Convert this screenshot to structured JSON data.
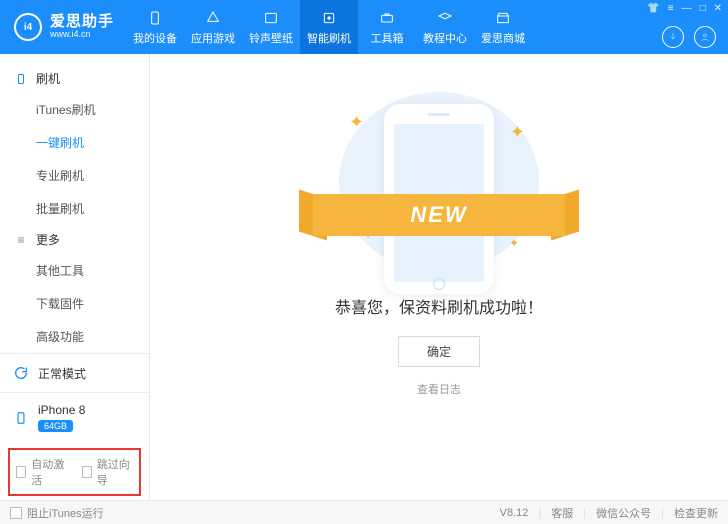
{
  "brand": {
    "name": "爱思助手",
    "url": "www.i4.cn",
    "logo_text": "i4"
  },
  "top_nav": [
    {
      "label": "我的设备"
    },
    {
      "label": "应用游戏"
    },
    {
      "label": "铃声壁纸"
    },
    {
      "label": "智能刷机",
      "active": true
    },
    {
      "label": "工具箱"
    },
    {
      "label": "教程中心"
    },
    {
      "label": "爱思商城"
    }
  ],
  "sidebar": {
    "groups": [
      {
        "title": "刷机",
        "items": [
          {
            "label": "iTunes刷机"
          },
          {
            "label": "一键刷机",
            "active": true
          },
          {
            "label": "专业刷机"
          },
          {
            "label": "批量刷机"
          }
        ]
      },
      {
        "title": "更多",
        "items": [
          {
            "label": "其他工具"
          },
          {
            "label": "下载固件"
          },
          {
            "label": "高级功能"
          }
        ]
      }
    ],
    "mode": "正常模式",
    "device": {
      "name": "iPhone 8",
      "storage": "64GB"
    },
    "options": [
      {
        "label": "自动激活"
      },
      {
        "label": "跳过向导"
      }
    ]
  },
  "main": {
    "ribbon": "NEW",
    "message": "恭喜您，保资料刷机成功啦！",
    "ok": "确定",
    "view_log": "查看日志"
  },
  "footer": {
    "block_itunes": "阻止iTunes运行",
    "version": "V8.12",
    "links": [
      "客服",
      "微信公众号",
      "检查更新"
    ]
  }
}
